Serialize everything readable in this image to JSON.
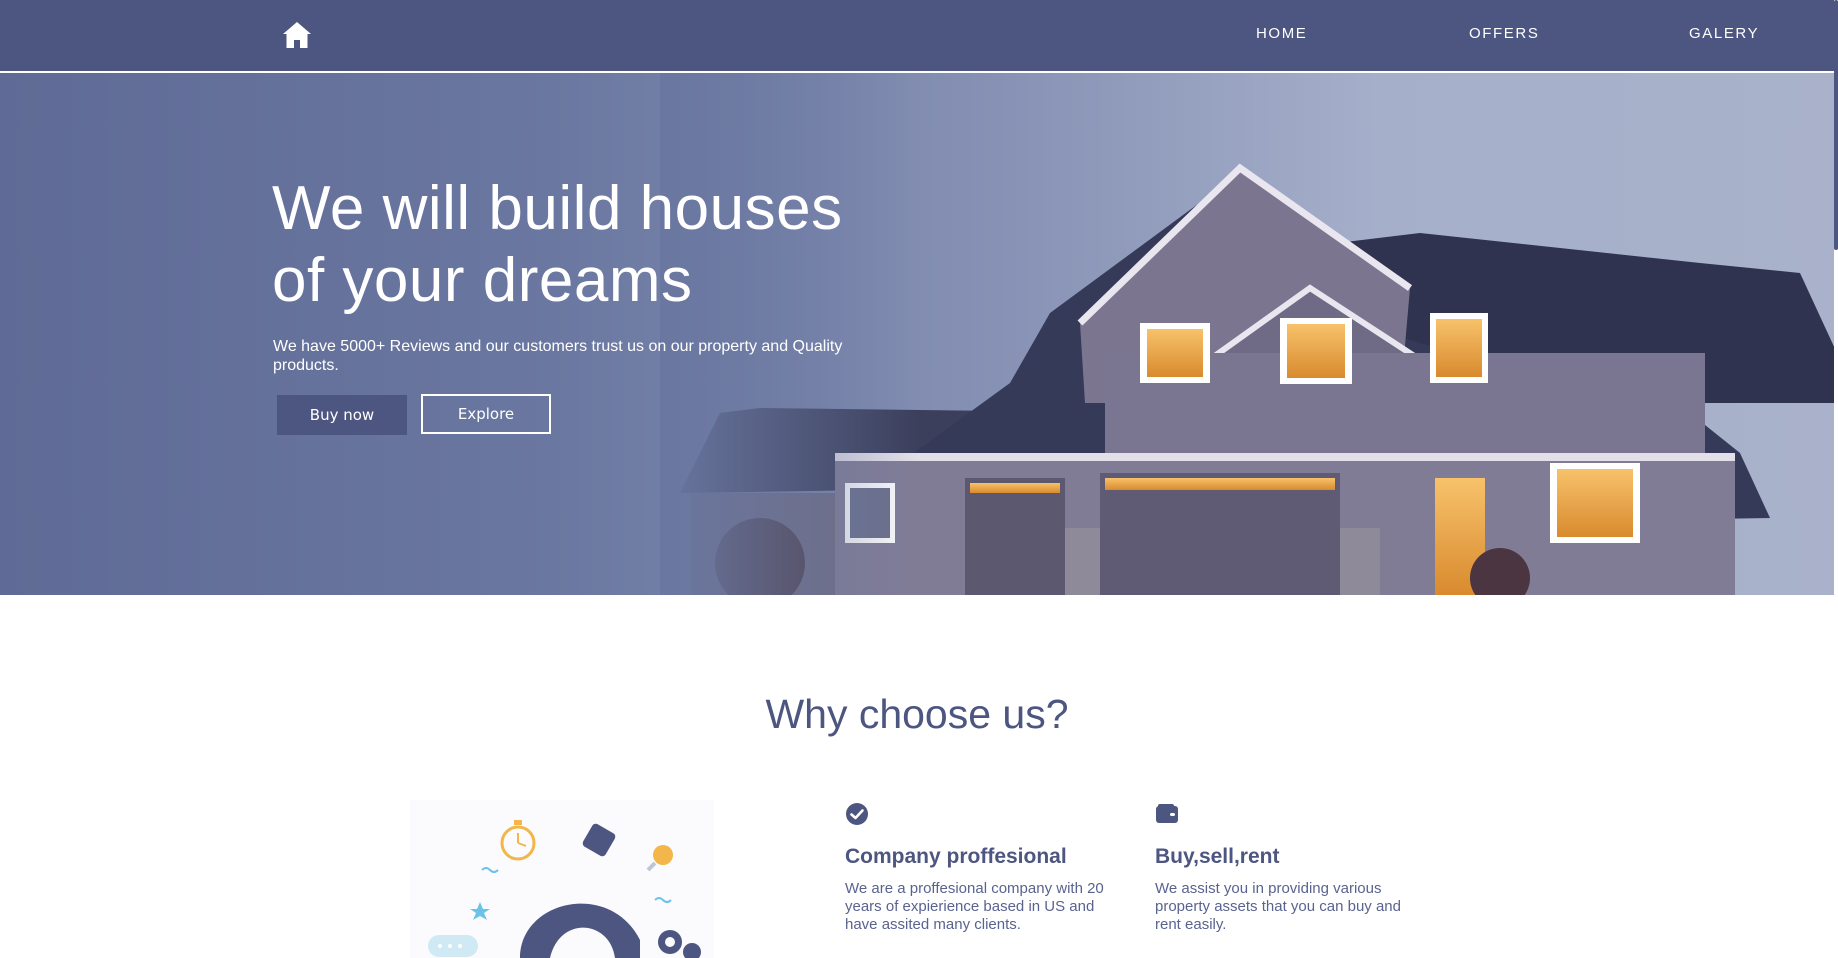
{
  "colors": {
    "brand": "#4d5680",
    "hero_left": "#5f6b96",
    "hero_right": "#a9b2ca",
    "text_on_dark": "#ffffff"
  },
  "nav": {
    "logo_icon": "home-icon",
    "links": [
      "HOME",
      "OFFERS",
      "GALERY"
    ]
  },
  "hero": {
    "title": "We will build houses of your dreams",
    "subtitle": "We have 5000+ Reviews and our customers trust us on our property and Quality products.",
    "buttons": {
      "buy": "Buy now",
      "explore": "Explore"
    }
  },
  "why": {
    "title": "Why choose us?",
    "features": [
      {
        "icon": "check-circle-icon",
        "title": "Company proffesional",
        "text": "We are a proffesional company with 20 years of expierience based in US and have assited many clients."
      },
      {
        "icon": "wallet-icon",
        "title": "Buy,sell,rent",
        "text": "We assist you in providing various property assets that you can buy and rent easily."
      }
    ]
  }
}
